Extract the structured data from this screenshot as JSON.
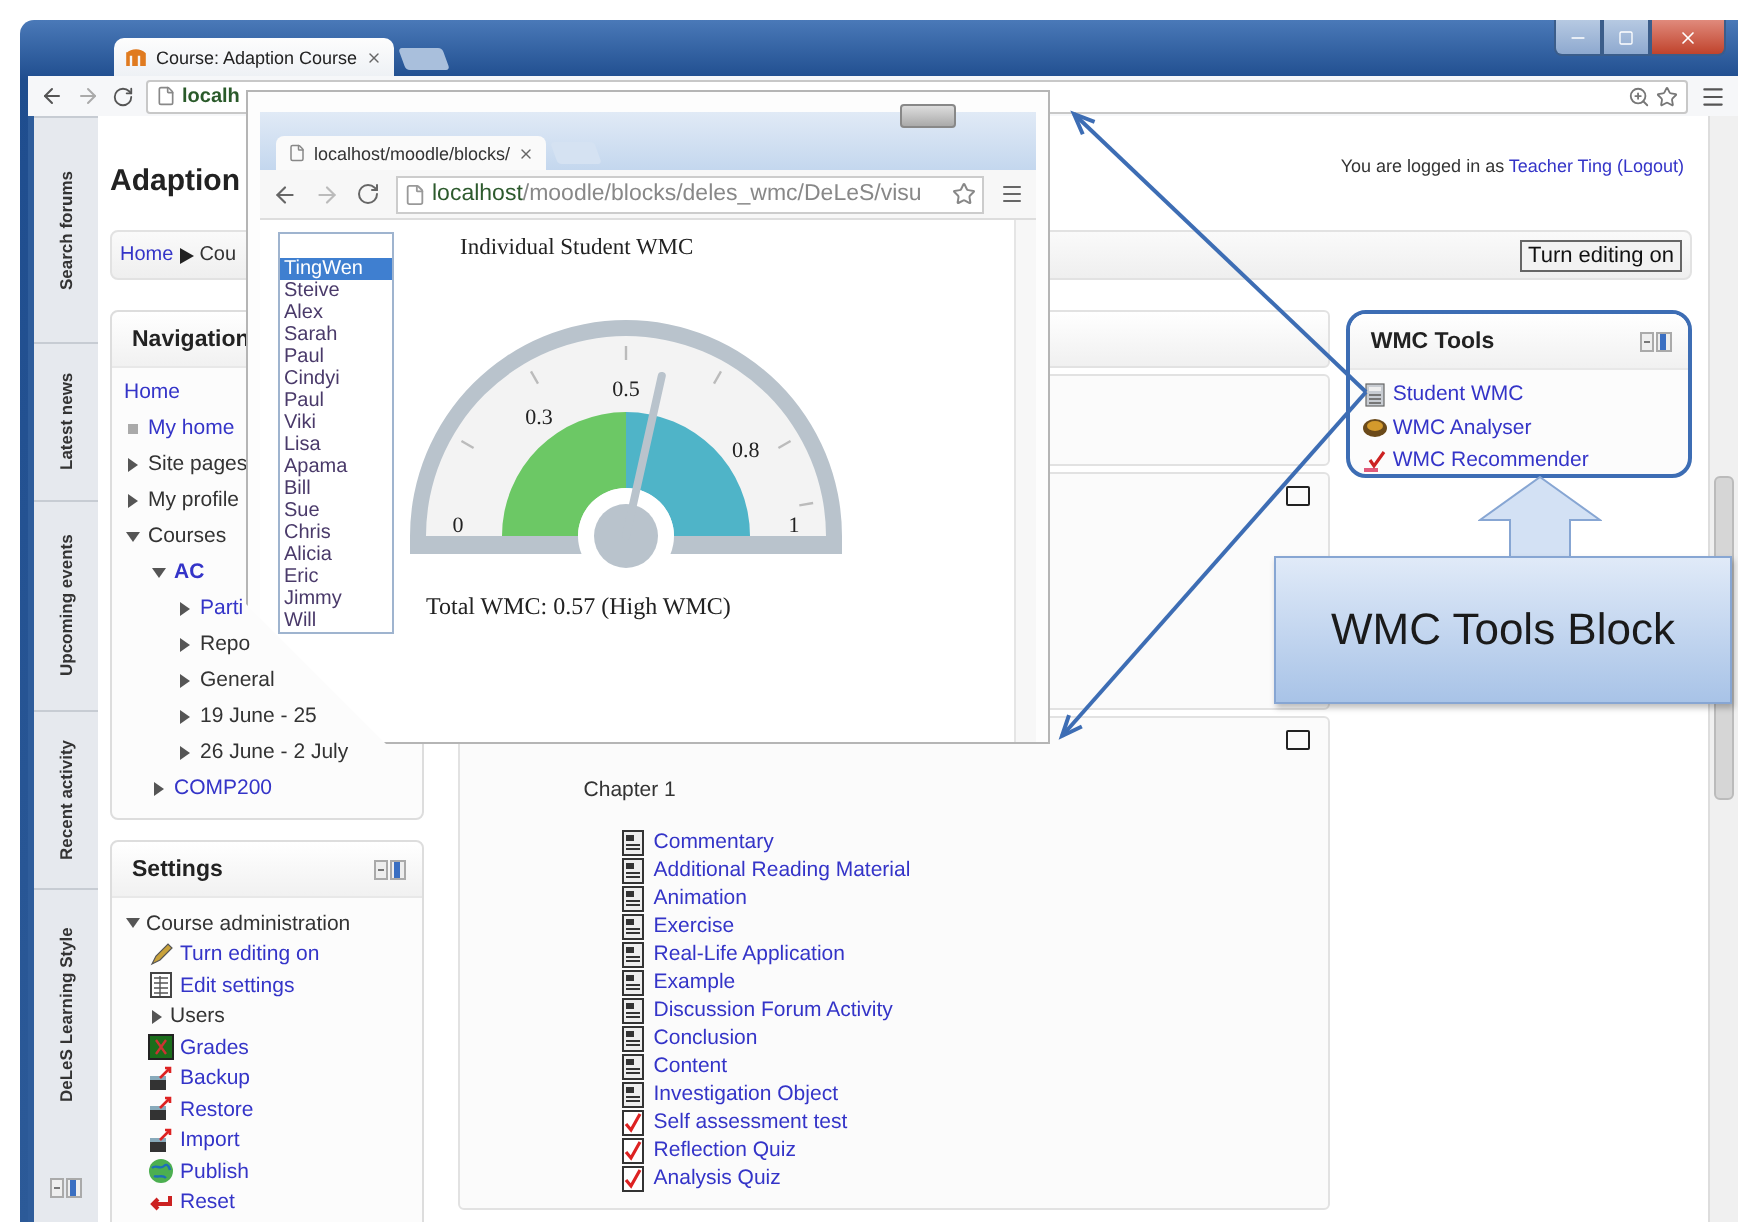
{
  "browser": {
    "tab": "Course: Adaption Course",
    "address": "localh"
  },
  "dock": [
    "Search forums",
    "Latest news",
    "Upcoming events",
    "Recent activity",
    "DeLeS Learning Style"
  ],
  "page": {
    "title": "Adaption",
    "login": {
      "prefix": "You are logged in as",
      "user": "Teacher Ting",
      "logout": "(Logout)"
    },
    "breadcrumb": [
      "Home",
      "Cou"
    ],
    "edit_button": "Turn editing on"
  },
  "navigation": {
    "title": "Navigation",
    "items": [
      {
        "label": "Home",
        "kind": "plain",
        "link": true,
        "current": false
      },
      {
        "label": "My home",
        "kind": "bullet",
        "link": true,
        "current": false
      },
      {
        "label": "Site pages",
        "kind": "branch",
        "link": false,
        "current": false,
        "expanded": false
      },
      {
        "label": "My profile",
        "kind": "branch",
        "link": false,
        "current": false,
        "expanded": false
      },
      {
        "label": "Courses",
        "kind": "branch",
        "link": false,
        "current": false,
        "expanded": true,
        "children": [
          {
            "label": "AC",
            "kind": "branch",
            "link": true,
            "current": true,
            "expanded": true,
            "children": [
              {
                "label": "Parti",
                "kind": "branch",
                "link": true,
                "current": false,
                "expanded": false
              },
              {
                "label": "Repo",
                "kind": "branch",
                "link": false,
                "current": false,
                "expanded": false
              },
              {
                "label": "General",
                "kind": "branch",
                "link": false,
                "current": false,
                "expanded": false
              },
              {
                "label": "19 June - 25",
                "kind": "branch",
                "link": false,
                "current": false,
                "expanded": false
              },
              {
                "label": "26 June - 2 July",
                "kind": "branch",
                "link": false,
                "current": false,
                "expanded": false
              }
            ]
          },
          {
            "label": "COMP200",
            "kind": "branch",
            "link": true,
            "current": false,
            "expanded": false
          }
        ]
      }
    ]
  },
  "settings": {
    "title": "Settings",
    "items": [
      {
        "label": "Course administration",
        "kind": "branch",
        "expanded": true,
        "children": [
          {
            "label": "Turn editing on",
            "kind": "pencil"
          },
          {
            "label": "Edit settings",
            "kind": "document"
          },
          {
            "label": "Users",
            "kind": "branch",
            "expanded": false
          },
          {
            "label": "Grades",
            "kind": "grades"
          },
          {
            "label": "Backup",
            "kind": "backup"
          },
          {
            "label": "Restore",
            "kind": "restore"
          },
          {
            "label": "Import",
            "kind": "import"
          },
          {
            "label": "Publish",
            "kind": "publish"
          },
          {
            "label": "Reset",
            "kind": "reset"
          }
        ]
      }
    ]
  },
  "chapter": {
    "title": "Chapter 1",
    "items": [
      {
        "label": "Commentary",
        "kind": "page"
      },
      {
        "label": "Additional Reading Material",
        "kind": "page"
      },
      {
        "label": "Animation",
        "kind": "page"
      },
      {
        "label": "Exercise",
        "kind": "page"
      },
      {
        "label": "Real-Life Application",
        "kind": "page"
      },
      {
        "label": "Example",
        "kind": "page"
      },
      {
        "label": "Discussion Forum Activity",
        "kind": "page"
      },
      {
        "label": "Conclusion",
        "kind": "page"
      },
      {
        "label": "Content",
        "kind": "page"
      },
      {
        "label": "Investigation Object",
        "kind": "page"
      },
      {
        "label": "Self assessment test",
        "kind": "quiz"
      },
      {
        "label": "Reflection Quiz",
        "kind": "quiz"
      },
      {
        "label": "Analysis Quiz",
        "kind": "quiz"
      }
    ]
  },
  "wmc_tools": {
    "title": "WMC Tools",
    "items": [
      {
        "label": "Student WMC",
        "kind": "report"
      },
      {
        "label": "WMC Analyser",
        "kind": "analyser"
      },
      {
        "label": "WMC Recommender",
        "kind": "recommender"
      }
    ]
  },
  "callout": "WMC Tools Block",
  "popup": {
    "tab": "localhost/moodle/blocks/",
    "address": "**localhost**/moodle/blocks/deles_wmc/DeLeS/visu",
    "students": [
      {
        "name": "TingWen",
        "selected": true
      },
      {
        "name": "Steive",
        "selected": false
      },
      {
        "name": "Alex",
        "selected": false
      },
      {
        "name": "Sarah",
        "selected": false
      },
      {
        "name": "Paul",
        "selected": false
      },
      {
        "name": "Cindyi",
        "selected": false
      },
      {
        "name": "Paul",
        "selected": false
      },
      {
        "name": "Viki",
        "selected": false
      },
      {
        "name": "Lisa",
        "selected": false
      },
      {
        "name": "Apama",
        "selected": false
      },
      {
        "name": "Bill",
        "selected": false
      },
      {
        "name": "Sue",
        "selected": false
      },
      {
        "name": "Chris",
        "selected": false
      },
      {
        "name": "Alicia",
        "selected": false
      },
      {
        "name": "Eric",
        "selected": false
      },
      {
        "name": "Jimmy",
        "selected": false
      },
      {
        "name": "Will",
        "selected": false
      }
    ],
    "title": "Individual Student WMC",
    "gauge": {
      "ticks": [
        "0",
        "0.3",
        "0.5",
        "0.8",
        "1"
      ]
    },
    "total": "Total WMC: 0.57 (High WMC)"
  }
}
